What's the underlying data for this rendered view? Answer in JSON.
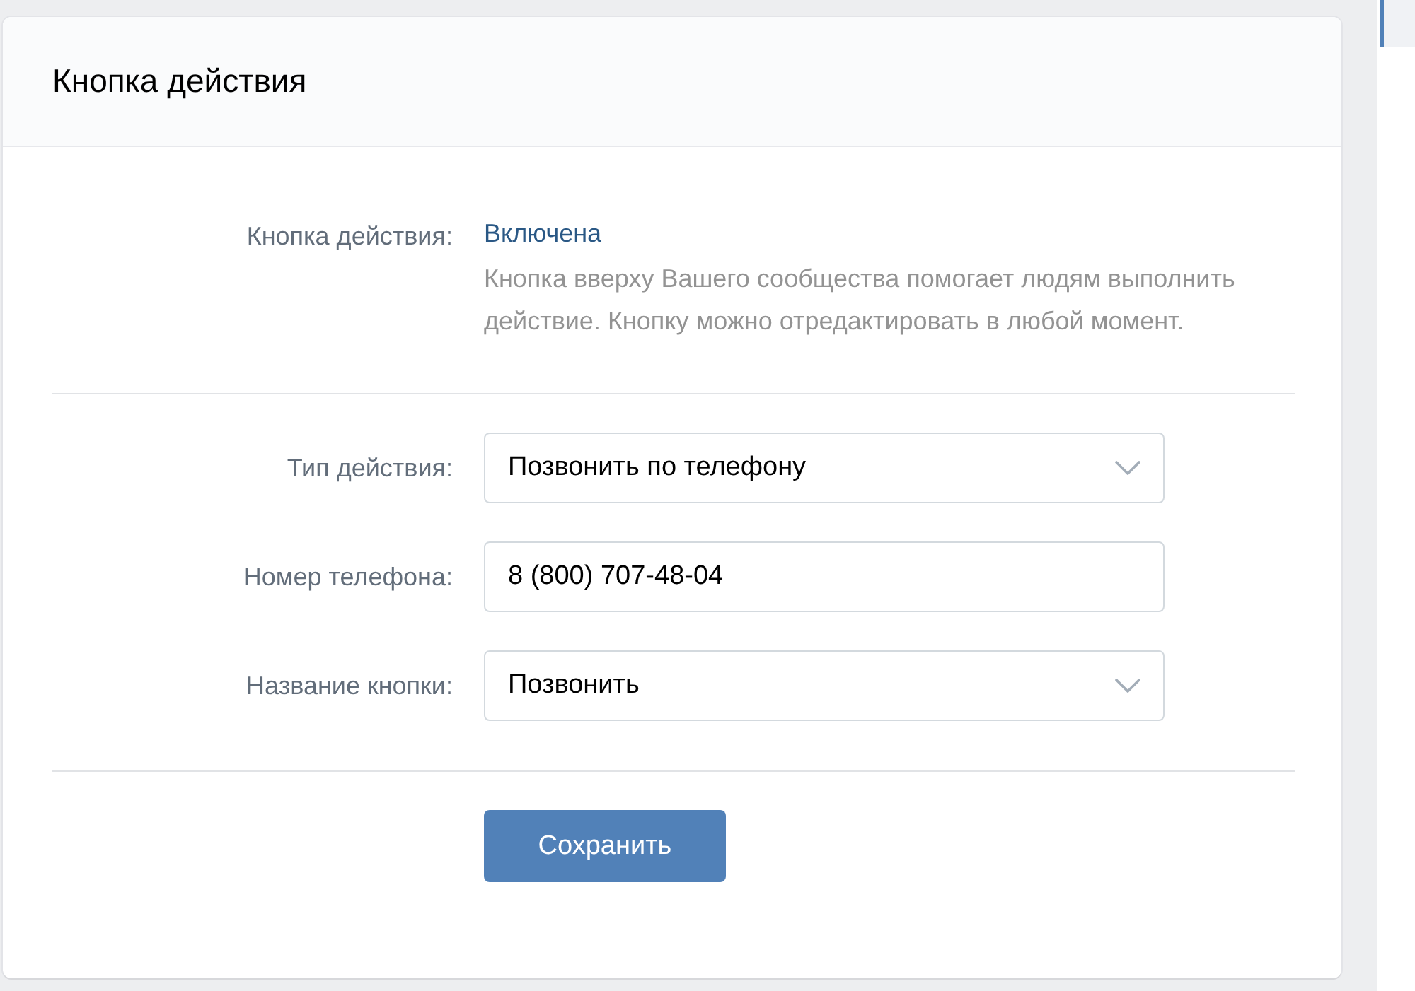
{
  "header": {
    "title": "Кнопка действия"
  },
  "status": {
    "label": "Кнопка действия:",
    "value": "Включена",
    "description": "Кнопка вверху Вашего сообщества помогает людям выполнить действие. Кнопку можно отредактировать в любой момент."
  },
  "fields": [
    {
      "kind": "select",
      "label": "Тип действия:",
      "value": "Позвонить по телефону"
    },
    {
      "kind": "input",
      "label": "Номер телефона:",
      "value": "8 (800) 707-48-04"
    },
    {
      "kind": "select",
      "label": "Название кнопки:",
      "value": "Позвонить"
    }
  ],
  "save_button": "Сохранить"
}
